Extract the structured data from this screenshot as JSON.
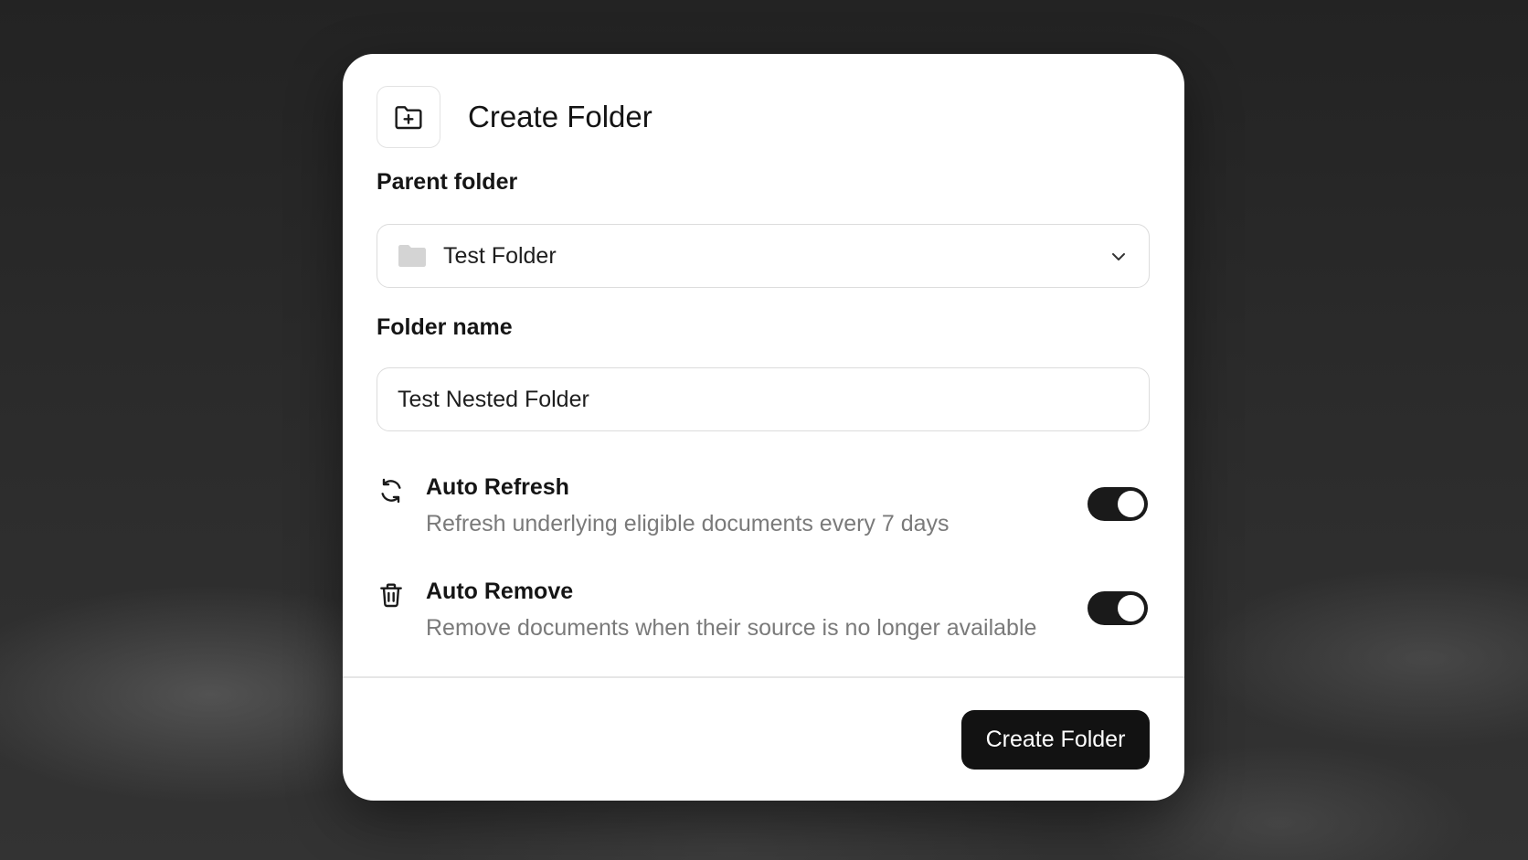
{
  "dialog": {
    "title": "Create Folder",
    "header_icon": "folder-plus-icon"
  },
  "parent_folder": {
    "label": "Parent folder",
    "selected_value": "Test Folder",
    "icon": "folder-icon"
  },
  "folder_name": {
    "label": "Folder name",
    "value": "Test Nested Folder"
  },
  "options": [
    {
      "title": "Auto Refresh",
      "description": "Refresh underlying eligible documents every 7 days",
      "icon": "refresh-icon",
      "enabled": true
    },
    {
      "title": "Auto Remove",
      "description": "Remove documents when their source is no longer available",
      "icon": "trash-icon",
      "enabled": true
    }
  ],
  "footer": {
    "create_label": "Create Folder"
  },
  "colors": {
    "primary": "#121212",
    "muted_text": "#7a7a7a",
    "border": "#dcdcdc"
  }
}
